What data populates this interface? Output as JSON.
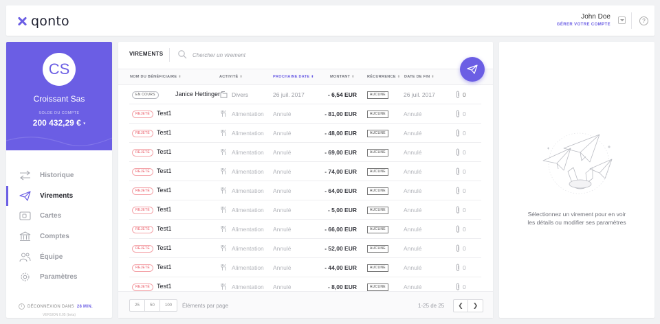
{
  "app": {
    "logo_text": "qonto"
  },
  "user": {
    "name": "John Doe",
    "manage_label": "GÉRER VOTRE COMPTE"
  },
  "account": {
    "initials": "CS",
    "company": "Croissant Sas",
    "balance_label": "SOLDE DU COMPTE",
    "balance": "200 432,29 €",
    "balance_caret": "▾"
  },
  "nav": {
    "items": [
      {
        "label": "Historique",
        "icon": "arrows-swap-icon",
        "active": false
      },
      {
        "label": "Virements",
        "icon": "paper-plane-icon",
        "active": true
      },
      {
        "label": "Cartes",
        "icon": "card-icon",
        "active": false
      },
      {
        "label": "Comptes",
        "icon": "bank-icon",
        "active": false
      },
      {
        "label": "Équipe",
        "icon": "team-icon",
        "active": false
      },
      {
        "label": "Paramètres",
        "icon": "gear-icon",
        "active": false
      }
    ]
  },
  "session": {
    "logout_prefix": "DÉCONNEXION DANS",
    "logout_time": "28 MIN.",
    "version": "VERSION 0.05 (beta)"
  },
  "main": {
    "title": "VIREMENTS",
    "search_placeholder": "Chercher un virement",
    "columns": {
      "beneficiary": "NOM DU BÉNÉFICIAIRE",
      "activity": "ACTIVITÉ",
      "next_date": "PROCHAINE DATE",
      "amount": "MONTANT",
      "recurrence": "RÉCURRENCE",
      "end_date": "DATE DE FIN"
    },
    "sort_glyph": "⬍",
    "sort_active_glyph": "⬍"
  },
  "transfers": [
    {
      "status": "EN COURS",
      "status_type": "pending",
      "beneficiary": "Janice Hettinger",
      "activity": "Divers",
      "activity_icon": "folder-icon",
      "next_date": "26 juil. 2017",
      "amount": "- 6,54 EUR",
      "recurrence": "AUCUNE",
      "end_date": "26 juil. 2017",
      "attachments": "0"
    },
    {
      "status": "REJETÉ",
      "status_type": "rejected",
      "beneficiary": "Test1",
      "activity": "Alimentation",
      "activity_icon": "fork-knife-icon",
      "next_date": "Annulé",
      "amount": "- 81,00 EUR",
      "recurrence": "AUCUNE",
      "end_date": "Annulé",
      "attachments": "0"
    },
    {
      "status": "REJETÉ",
      "status_type": "rejected",
      "beneficiary": "Test1",
      "activity": "Alimentation",
      "activity_icon": "fork-knife-icon",
      "next_date": "Annulé",
      "amount": "- 48,00 EUR",
      "recurrence": "AUCUNE",
      "end_date": "Annulé",
      "attachments": "0"
    },
    {
      "status": "REJETÉ",
      "status_type": "rejected",
      "beneficiary": "Test1",
      "activity": "Alimentation",
      "activity_icon": "fork-knife-icon",
      "next_date": "Annulé",
      "amount": "- 69,00 EUR",
      "recurrence": "AUCUNE",
      "end_date": "Annulé",
      "attachments": "0"
    },
    {
      "status": "REJETÉ",
      "status_type": "rejected",
      "beneficiary": "Test1",
      "activity": "Alimentation",
      "activity_icon": "fork-knife-icon",
      "next_date": "Annulé",
      "amount": "- 74,00 EUR",
      "recurrence": "AUCUNE",
      "end_date": "Annulé",
      "attachments": "0"
    },
    {
      "status": "REJETÉ",
      "status_type": "rejected",
      "beneficiary": "Test1",
      "activity": "Alimentation",
      "activity_icon": "fork-knife-icon",
      "next_date": "Annulé",
      "amount": "- 64,00 EUR",
      "recurrence": "AUCUNE",
      "end_date": "Annulé",
      "attachments": "0"
    },
    {
      "status": "REJETÉ",
      "status_type": "rejected",
      "beneficiary": "Test1",
      "activity": "Alimentation",
      "activity_icon": "fork-knife-icon",
      "next_date": "Annulé",
      "amount": "- 5,00 EUR",
      "recurrence": "AUCUNE",
      "end_date": "Annulé",
      "attachments": "0"
    },
    {
      "status": "REJETÉ",
      "status_type": "rejected",
      "beneficiary": "Test1",
      "activity": "Alimentation",
      "activity_icon": "fork-knife-icon",
      "next_date": "Annulé",
      "amount": "- 66,00 EUR",
      "recurrence": "AUCUNE",
      "end_date": "Annulé",
      "attachments": "0"
    },
    {
      "status": "REJETÉ",
      "status_type": "rejected",
      "beneficiary": "Test1",
      "activity": "Alimentation",
      "activity_icon": "fork-knife-icon",
      "next_date": "Annulé",
      "amount": "- 52,00 EUR",
      "recurrence": "AUCUNE",
      "end_date": "Annulé",
      "attachments": "0"
    },
    {
      "status": "REJETÉ",
      "status_type": "rejected",
      "beneficiary": "Test1",
      "activity": "Alimentation",
      "activity_icon": "fork-knife-icon",
      "next_date": "Annulé",
      "amount": "- 44,00 EUR",
      "recurrence": "AUCUNE",
      "end_date": "Annulé",
      "attachments": "0"
    },
    {
      "status": "REJETÉ",
      "status_type": "rejected",
      "beneficiary": "Test1",
      "activity": "Alimentation",
      "activity_icon": "fork-knife-icon",
      "next_date": "Annulé",
      "amount": "- 8,00 EUR",
      "recurrence": "AUCUNE",
      "end_date": "Annulé",
      "attachments": "0"
    }
  ],
  "footer": {
    "page_sizes": [
      "25",
      "50",
      "100"
    ],
    "page_size_label": "Éléments par page",
    "range": "1-25 de 25",
    "prev": "❮",
    "next": "❯"
  },
  "detail": {
    "message": "Sélectionnez un virement pour en voir les détails ou modifier ses paramètres"
  },
  "colors": {
    "brand": "#6b5ee4",
    "rejected": "#e84e5b",
    "background": "#f1f2f4"
  }
}
